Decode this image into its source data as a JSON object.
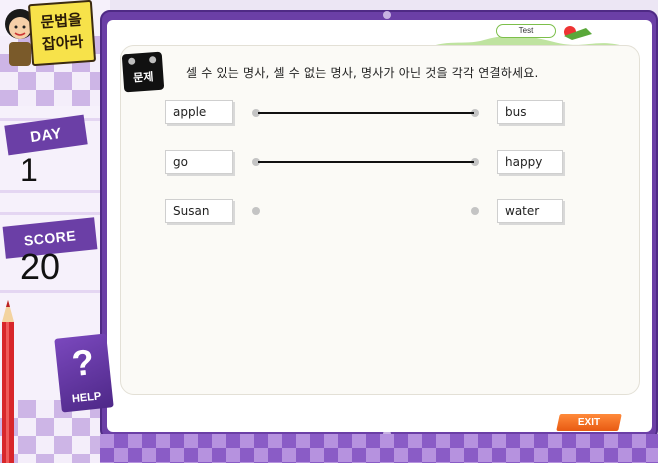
{
  "logo": {
    "title_line1": "문법을",
    "title_line2": "잡아라"
  },
  "day": {
    "label": "DAY",
    "value": "1"
  },
  "score": {
    "label": "SCORE",
    "value": "20"
  },
  "help": {
    "symbol": "?",
    "label": "HELP"
  },
  "test_tag": "Test",
  "question": {
    "icon_label": "문제",
    "text": "셀 수 있는 명사, 셀 수 없는 명사, 명사가 아닌 것을 각각 연결하세요."
  },
  "left_words": [
    "apple",
    "go",
    "Susan"
  ],
  "right_words": [
    "bus",
    "happy",
    "water"
  ],
  "connections": [
    {
      "from": "apple",
      "to": "bus"
    },
    {
      "from": "go",
      "to": "happy"
    }
  ],
  "exit_label": "EXIT",
  "colors": {
    "frame": "#6b3fa6",
    "exit": "#e85a12",
    "day_badge": "#6b3fa6"
  }
}
